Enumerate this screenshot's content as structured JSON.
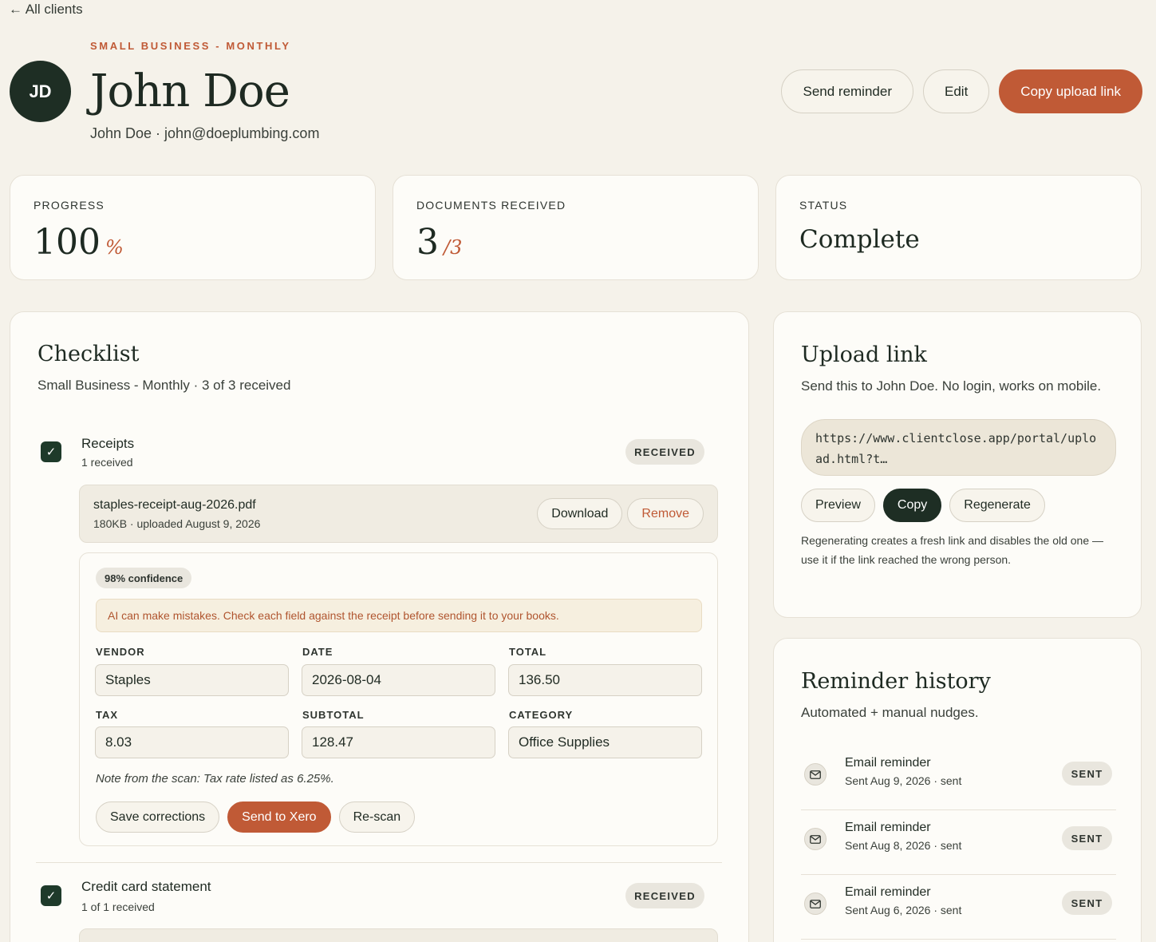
{
  "nav": {
    "back_label": "← All clients"
  },
  "client": {
    "eyebrow": "SMALL BUSINESS - MONTHLY",
    "initials": "JD",
    "name": "John Doe",
    "contact": "John Doe · john@doeplumbing.com"
  },
  "header_actions": {
    "send_reminder": "Send reminder",
    "edit": "Edit",
    "copy_upload_link": "Copy upload link"
  },
  "stats": {
    "progress": {
      "label": "PROGRESS",
      "value": "100",
      "unit": "%"
    },
    "documents": {
      "label": "DOCUMENTS RECEIVED",
      "value": "3",
      "total": "/3"
    },
    "status": {
      "label": "STATUS",
      "value": "Complete"
    }
  },
  "checklist": {
    "title": "Checklist",
    "subtitle": "Small Business - Monthly · 3 of 3 received",
    "items": [
      {
        "title": "Receipts",
        "sub": "1 received",
        "badge": "RECEIVED",
        "file": {
          "name": "staples-receipt-aug-2026.pdf",
          "meta": "180KB · uploaded August 9, 2026",
          "download": "Download",
          "remove": "Remove"
        },
        "scan": {
          "confidence": "98% confidence",
          "warning": "AI can make mistakes. Check each field against the receipt before sending it to your books.",
          "fields": {
            "vendor": {
              "label": "VENDOR",
              "value": "Staples"
            },
            "date": {
              "label": "DATE",
              "value": "2026-08-04"
            },
            "total": {
              "label": "TOTAL",
              "value": "136.50"
            },
            "tax": {
              "label": "TAX",
              "value": "8.03"
            },
            "subtotal": {
              "label": "SUBTOTAL",
              "value": "128.47"
            },
            "category": {
              "label": "CATEGORY",
              "value": "Office Supplies"
            }
          },
          "note": "Note from the scan: Tax rate listed as 6.25%.",
          "save": "Save corrections",
          "send": "Send to Xero",
          "rescan": "Re-scan"
        }
      },
      {
        "title": "Credit card statement",
        "sub": "1 of 1 received",
        "badge": "RECEIVED"
      }
    ]
  },
  "upload_link": {
    "title": "Upload link",
    "subtitle": "Send this to John Doe. No login, works on mobile.",
    "url": "https://www.clientclose.app/portal/upload.html?t…",
    "preview": "Preview",
    "copy": "Copy",
    "regenerate": "Regenerate",
    "note": "Regenerating creates a fresh link and disables the old one — use it if the link reached the wrong person."
  },
  "reminders": {
    "title": "Reminder history",
    "subtitle": "Automated + manual nudges.",
    "items": [
      {
        "title": "Email reminder",
        "sub": "Sent Aug 9, 2026 · sent",
        "badge": "SENT"
      },
      {
        "title": "Email reminder",
        "sub": "Sent Aug 8, 2026 · sent",
        "badge": "SENT"
      },
      {
        "title": "Email reminder",
        "sub": "Sent Aug 6, 2026 · sent",
        "badge": "SENT"
      }
    ]
  },
  "colors": {
    "accent": "#c05a36",
    "dark": "#1e2e24",
    "background": "#f5f2ea",
    "card": "#fdfcf8"
  },
  "icons": [
    "check-icon",
    "mail-icon",
    "arrow-left-icon"
  ]
}
